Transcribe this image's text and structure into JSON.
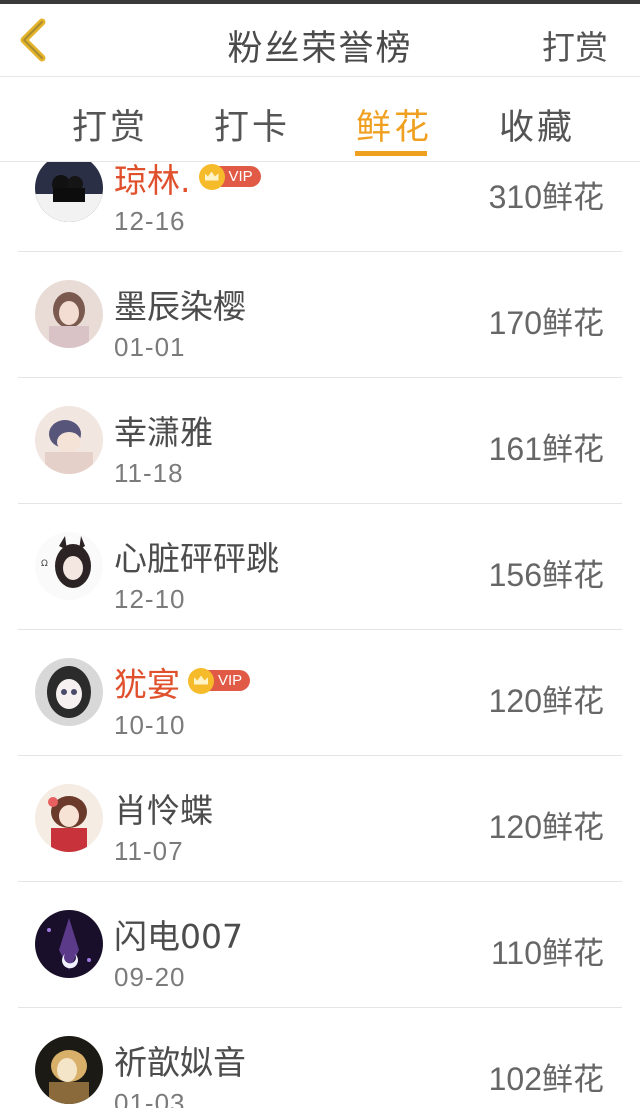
{
  "header": {
    "title": "粉丝荣誉榜",
    "right_action": "打赏",
    "back_icon": "chevron-left-icon",
    "back_color": "#e4b52b"
  },
  "tabs": [
    {
      "label": "打赏",
      "active": false
    },
    {
      "label": "打卡",
      "active": false
    },
    {
      "label": "鲜花",
      "active": true
    },
    {
      "label": "收藏",
      "active": false
    }
  ],
  "colors": {
    "accent": "#f0a020",
    "vip_name": "#e0502c",
    "vip_badge": "#e05a46"
  },
  "vip_label": "VIP",
  "unit": "鲜花",
  "fans": [
    {
      "name": "琼林.",
      "vip": true,
      "date": "12-16",
      "amount": "310"
    },
    {
      "name": "墨辰染樱",
      "vip": false,
      "date": "01-01",
      "amount": "170"
    },
    {
      "name": "幸潇雅",
      "vip": false,
      "date": "11-18",
      "amount": "161"
    },
    {
      "name": "心脏砰砰跳",
      "vip": false,
      "date": "12-10",
      "amount": "156"
    },
    {
      "name": "犹宴",
      "vip": true,
      "date": "10-10",
      "amount": "120"
    },
    {
      "name": "肖怜蝶",
      "vip": false,
      "date": "11-07",
      "amount": "120"
    },
    {
      "name": "闪电007",
      "vip": false,
      "date": "09-20",
      "amount": "110"
    },
    {
      "name": "祈歆姒音",
      "vip": false,
      "date": "01-03",
      "amount": "102"
    }
  ]
}
